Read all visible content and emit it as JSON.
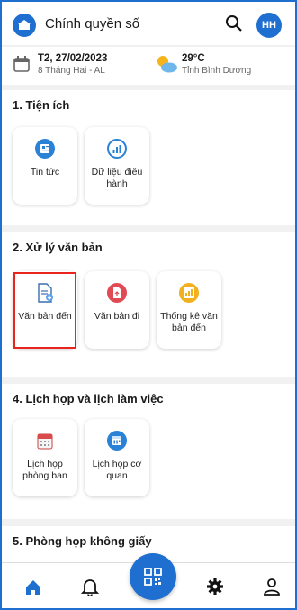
{
  "header": {
    "title": "Chính quyền số",
    "avatar_initials": "HH"
  },
  "info": {
    "date": "T2, 27/02/2023",
    "lunar": "8 Tháng Hai - AL",
    "temperature": "29°C",
    "location": "Tỉnh Bình Dương"
  },
  "sections": [
    {
      "title": "1. Tiện ích",
      "items": [
        {
          "label": "Tin tức",
          "icon": "news-icon"
        },
        {
          "label": "Dữ liệu điều hành",
          "icon": "chart-icon"
        }
      ]
    },
    {
      "title": "2. Xử lý văn bản",
      "items": [
        {
          "label": "Văn bản đến",
          "icon": "incoming-document-icon"
        },
        {
          "label": "Văn bản đi",
          "icon": "outgoing-document-icon"
        },
        {
          "label": "Thống kê văn bản đến",
          "icon": "statistics-icon"
        }
      ]
    },
    {
      "title": "4. Lịch họp và lịch làm việc",
      "items": [
        {
          "label": "Lịch họp phòng ban",
          "icon": "calendar-icon"
        },
        {
          "label": "Lịch họp cơ quan",
          "icon": "calendar-icon"
        }
      ]
    },
    {
      "title": "5. Phòng họp không giấy"
    }
  ],
  "colors": {
    "accent": "#1f6fd1",
    "highlight": "#e8241c"
  }
}
